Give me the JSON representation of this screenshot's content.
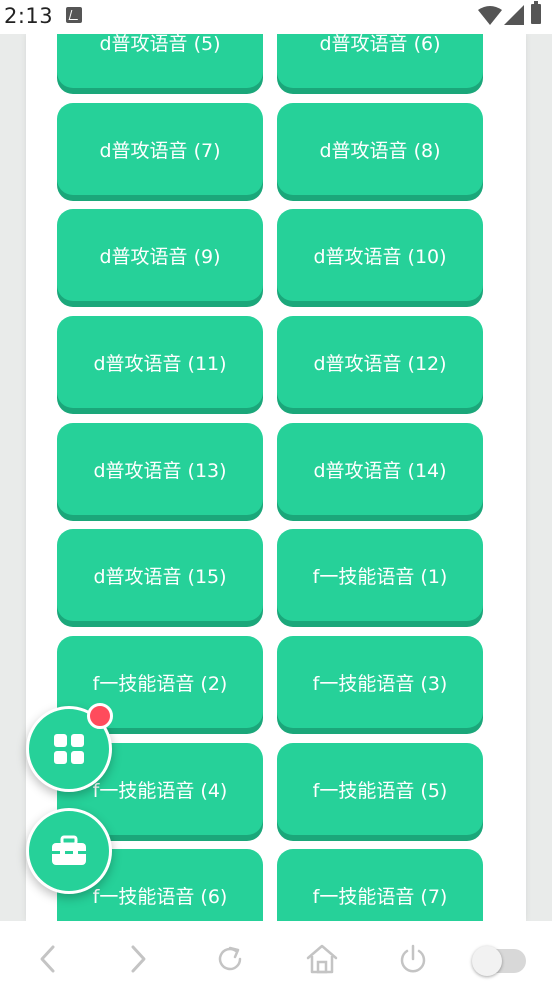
{
  "status_bar": {
    "time": "2:13",
    "icons": [
      "notification-a-icon",
      "wifi-icon",
      "signal-icon",
      "battery-icon"
    ]
  },
  "buttons": [
    "d普攻语音 (5)",
    "d普攻语音 (6)",
    "d普攻语音 (7)",
    "d普攻语音 (8)",
    "d普攻语音 (9)",
    "d普攻语音 (10)",
    "d普攻语音 (11)",
    "d普攻语音 (12)",
    "d普攻语音 (13)",
    "d普攻语音 (14)",
    "d普攻语音 (15)",
    "f一技能语音 (1)",
    "f一技能语音 (2)",
    "f一技能语音 (3)",
    "f一技能语音 (4)",
    "f一技能语音 (5)",
    "f一技能语音 (6)",
    "f一技能语音 (7)"
  ],
  "floating_buttons": [
    {
      "icon": "grid-icon",
      "has_badge": true
    },
    {
      "icon": "toolbox-icon",
      "has_badge": false
    }
  ],
  "nav_bar": {
    "items": [
      "back-icon",
      "forward-icon",
      "refresh-icon",
      "home-icon",
      "power-icon",
      "toggle-switch"
    ],
    "toggle_on": false
  },
  "colors": {
    "accent": "#26d199",
    "accent_shadow": "#1ba77a",
    "badge": "#ff4b5c",
    "nav_icon": "#c4c4c4"
  }
}
